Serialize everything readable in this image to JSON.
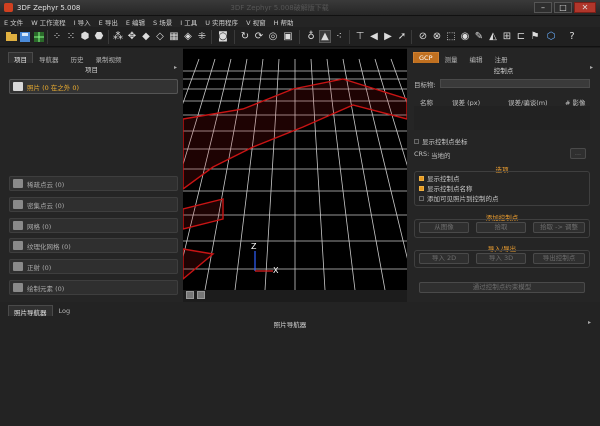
{
  "window": {
    "title": "3DF Zephyr 5.008",
    "ghost_title": "3DF Zephyr 5.008破解版下载",
    "buttons": {
      "minimize": "–",
      "maximize": "□",
      "close": "✕"
    }
  },
  "menu": [
    "E 文件",
    "W 工作流程",
    "I 导入",
    "E 导出",
    "E 编辑",
    "S 场景",
    "I 工具",
    "U 实用程序",
    "V 视窗",
    "H 帮助"
  ],
  "toolbar_icons": [
    "folder-icon",
    "save-icon",
    "grid-icon",
    "sparse-cloud-icon",
    "dense-cloud-icon",
    "mesh-icon",
    "textured-mesh-icon",
    "cube-icon",
    "points-icon",
    "camera-icon",
    "rotate-icon",
    "refresh-icon",
    "record-icon",
    "bulb-icon",
    "triangle-icon",
    "points-triangle-icon",
    "undo-icon",
    "redo-icon",
    "arrow-icon",
    "up-icon",
    "down-icon",
    "lasso-icon",
    "no-select-icon",
    "select-icon",
    "target-icon",
    "brush-icon",
    "bucket-icon",
    "filter-icon",
    "measure-icon",
    "box-icon",
    "help-icon"
  ],
  "left_panel": {
    "tabs": [
      "项目",
      "导航器",
      "历史",
      "录制视频"
    ],
    "title": "项目",
    "items": [
      {
        "label": "照片 (0 在之外 0)",
        "icon": "camera-icon"
      },
      {
        "label": "稀疏点云 (0)",
        "icon": "sparse-cloud-icon"
      },
      {
        "label": "密集点云 (0)",
        "icon": "dense-cloud-icon"
      },
      {
        "label": "网格 (0)",
        "icon": "mesh-icon"
      },
      {
        "label": "纹理化网格 (0)",
        "icon": "textured-mesh-icon"
      },
      {
        "label": "正射 (0)",
        "icon": "image-icon"
      },
      {
        "label": "绘制元素 (0)",
        "icon": "draw-icon"
      }
    ]
  },
  "viewport": {
    "axes": {
      "z": "Z",
      "x": "X"
    },
    "colors": {
      "grid": "#c8c8c8",
      "highlight": "#c81414",
      "background": "#000000"
    }
  },
  "right_panel": {
    "tabs": [
      "GCP",
      "测量",
      "编辑",
      "注册"
    ],
    "title": "控制点",
    "target_label": "目标物:",
    "columns": [
      "名称",
      "误差 (px)",
      "误差/骗谈(m)",
      "# 影像"
    ],
    "show_coords": "显示控制点坐标",
    "crs_label": "CRS:",
    "crs_value": "当地的",
    "crs_button": "...",
    "options_title": "选项",
    "options": [
      {
        "label": "显示控制点",
        "checked": true
      },
      {
        "label": "显示控制点名称",
        "checked": true
      },
      {
        "label": "添加可见照片到控制的点",
        "checked": false
      }
    ],
    "add_title": "添加控制点",
    "add_buttons": [
      "从图像",
      "拾取",
      "拾取 -> 调整"
    ],
    "io_title": "导入/导出",
    "io_buttons": [
      "导入 2D",
      "导入 3D",
      "导出控制点"
    ],
    "update_button": "通过控制点约束模型",
    "accent": "#e89a20"
  },
  "bottom_panel": {
    "tabs": [
      "照片导航器",
      "Log"
    ],
    "title": "照片导航器"
  }
}
